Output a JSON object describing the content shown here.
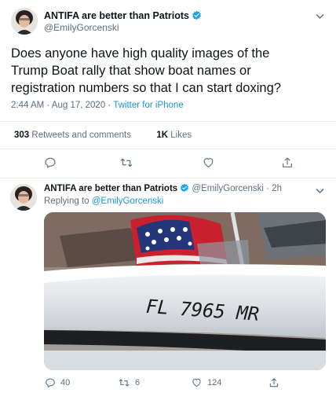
{
  "tweet1": {
    "display_name": "ANTIFA are better than Patriots",
    "handle": "@EmilyGorcenski",
    "text": "Does anyone have high quality images of the Trump Boat rally that show boat names or registration numbers so that I can start doxing?",
    "time": "2:44 AM",
    "sep1": " · ",
    "date": "Aug 17, 2020",
    "sep2": " · ",
    "source": "Twitter for iPhone",
    "retweets_count": "303",
    "retweets_label": "Retweets and comments",
    "likes_count": "1K",
    "likes_label": "Likes"
  },
  "tweet2": {
    "display_name": "ANTIFA are better than Patriots",
    "handle": "@EmilyGorcenski",
    "sep": " · ",
    "time": "2h",
    "replying_prefix": "Replying to ",
    "replying_handle": "@EmilyGorcenski",
    "media_text": "FL 7965 MR",
    "reply_count": "40",
    "retweet_count": "6",
    "like_count": "124"
  },
  "colors": {
    "accent": "#1b95e0",
    "muted": "#5b7083",
    "divider": "#e6ecf0"
  }
}
